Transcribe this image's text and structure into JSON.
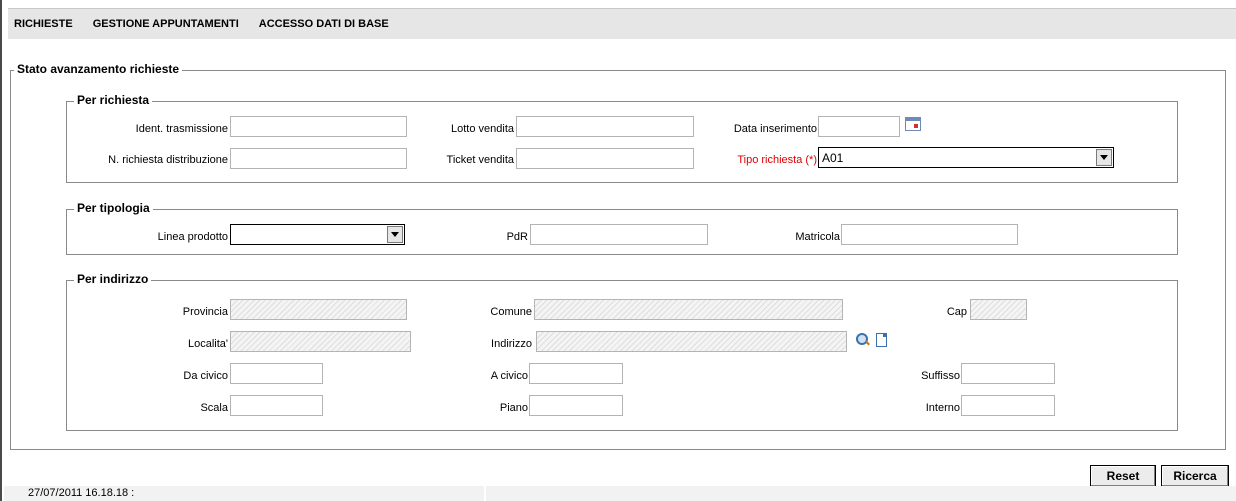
{
  "menu": [
    "RICHIESTE",
    "GESTIONE APPUNTAMENTI",
    "ACCESSO DATI DI BASE"
  ],
  "main_legend": "Stato avanzamento richieste",
  "per_richiesta": {
    "legend": "Per richiesta",
    "ident_trasmissione": {
      "label": "Ident. trasmissione",
      "value": ""
    },
    "lotto_vendita": {
      "label": "Lotto vendita",
      "value": ""
    },
    "data_inserimento": {
      "label": "Data inserimento",
      "value": "",
      "icon": "calendar-icon"
    },
    "n_richiesta_distribuzione": {
      "label": "N. richiesta distribuzione",
      "value": ""
    },
    "ticket_vendita": {
      "label": "Ticket vendita",
      "value": ""
    },
    "tipo_richiesta": {
      "label": "Tipo richiesta (*)",
      "value": "A01",
      "label_color": "#e00000"
    }
  },
  "per_tipologia": {
    "legend": "Per tipologia",
    "linea_prodotto": {
      "label": "Linea prodotto",
      "value": ""
    },
    "pdr": {
      "label": "PdR",
      "value": ""
    },
    "matricola": {
      "label": "Matricola",
      "value": ""
    }
  },
  "per_indirizzo": {
    "legend": "Per indirizzo",
    "provincia": {
      "label": "Provincia",
      "value": ""
    },
    "comune": {
      "label": "Comune",
      "value": ""
    },
    "cap": {
      "label": "Cap",
      "value": ""
    },
    "localita": {
      "label": "Localita'",
      "value": ""
    },
    "indirizzo": {
      "label": "Indirizzo",
      "value": "",
      "icons": [
        "search-icon",
        "document-icon"
      ]
    },
    "da_civico": {
      "label": "Da civico",
      "value": ""
    },
    "a_civico": {
      "label": "A civico",
      "value": ""
    },
    "suffisso": {
      "label": "Suffisso",
      "value": ""
    },
    "scala": {
      "label": "Scala",
      "value": ""
    },
    "piano": {
      "label": "Piano",
      "value": ""
    },
    "interno": {
      "label": "Interno",
      "value": ""
    }
  },
  "buttons": {
    "reset": "Reset",
    "ricerca": "Ricerca"
  },
  "status": {
    "timestamp": "27/07/2011 16.18.18  :"
  }
}
